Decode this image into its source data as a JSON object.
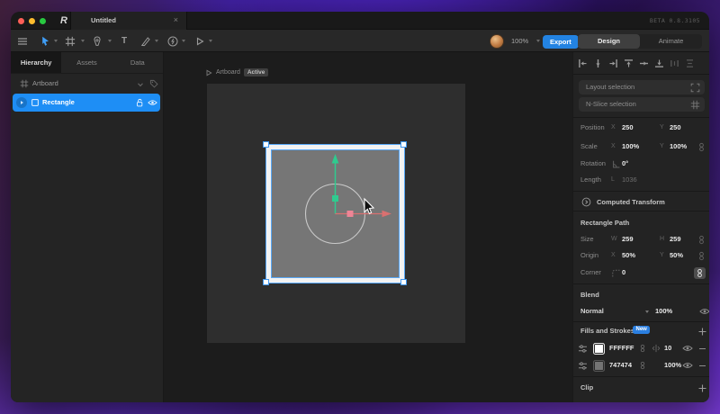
{
  "titlebar": {
    "logo_glyph": "R",
    "tab_title": "Untitled",
    "close_glyph": "×",
    "beta_label": "BETA 0.8.3105"
  },
  "toolbar": {
    "text_tool_glyph": "T",
    "zoom_level": "100%",
    "export_label": "Export",
    "design_label": "Design",
    "animate_label": "Animate"
  },
  "sidebar": {
    "tabs": [
      "Hierarchy",
      "Assets",
      "Data"
    ],
    "active_tab": "Hierarchy",
    "artboard_item": "Artboard",
    "rectangle_item": "Rectangle"
  },
  "canvas": {
    "artboard_name": "Artboard",
    "active_badge": "Active"
  },
  "inspector": {
    "layout_selection": "Layout selection",
    "nslice_selection": "N-Slice selection",
    "position": {
      "label": "Position",
      "ax": "X",
      "x": "250",
      "ay": "Y",
      "y": "250"
    },
    "scale": {
      "label": "Scale",
      "ax": "X",
      "x": "100%",
      "ay": "Y",
      "y": "100%"
    },
    "rotation": {
      "label": "Rotation",
      "value": "0°"
    },
    "length": {
      "label": "Length",
      "axis": "L",
      "value": "1036"
    },
    "computed_transform": "Computed Transform",
    "rect_path": {
      "title": "Rectangle Path",
      "size": {
        "label": "Size",
        "aw": "W",
        "w": "259",
        "ah": "H",
        "h": "259"
      },
      "origin": {
        "label": "Origin",
        "ax": "X",
        "x": "50%",
        "ay": "Y",
        "y": "50%"
      },
      "corner": {
        "label": "Corner",
        "value": "0"
      }
    },
    "blend": {
      "title": "Blend",
      "mode": "Normal",
      "opacity": "100%"
    },
    "fills": {
      "title": "Fills and Strokes",
      "badge": "New",
      "rows": [
        {
          "color": "FFFFFF",
          "value": "10"
        },
        {
          "color": "747474",
          "value": "100%"
        }
      ]
    },
    "clip_title": "Clip"
  },
  "colors": {
    "accent_blue": "#2383e2",
    "selection_blue": "#58a8f7",
    "hierarchy_selected": "#1e8ef5",
    "gizmo_green": "#2fcb8f",
    "gizmo_red": "#d97070",
    "gizmo_pink": "#ee8596",
    "rect_fill": "#747474",
    "artboard_bg": "#2e2e2e"
  }
}
